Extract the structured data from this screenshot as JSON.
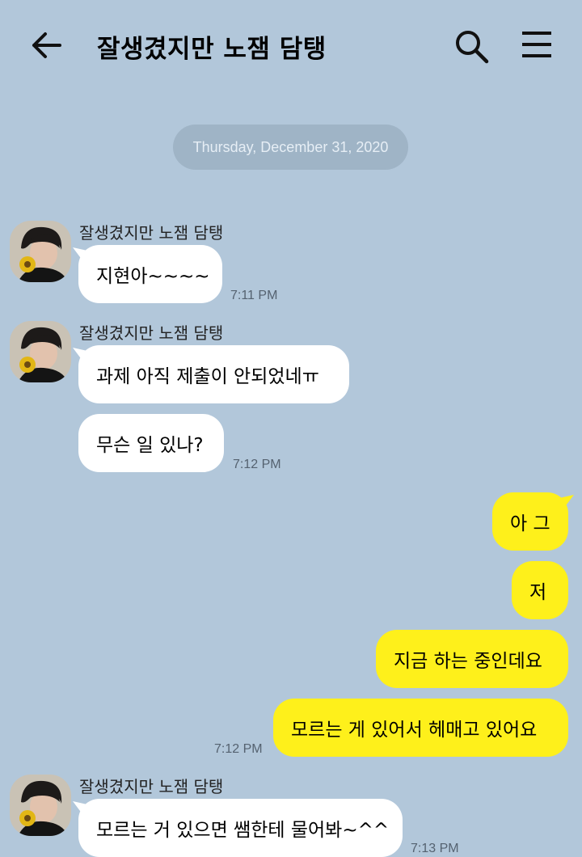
{
  "header": {
    "title": "잘생겼지만 노잼 담탱",
    "back_icon": "arrow-left-icon",
    "search_icon": "search-icon",
    "menu_icon": "hamburger-menu-icon"
  },
  "date_divider": "Thursday, December 31, 2020",
  "sender_name": "잘생겼지만 노잼 담탱",
  "messages": [
    {
      "text": "지현아~~~~",
      "time": "7:11 PM"
    },
    {
      "text": "과제 아직 제출이 안되었네ㅠ"
    },
    {
      "text": "무슨 일 있나?",
      "time": "7:12 PM"
    },
    {
      "text": "아 그"
    },
    {
      "text": "저"
    },
    {
      "text": "지금 하는 중인데요"
    },
    {
      "text": "모르는 게 있어서 헤매고 있어요",
      "time": "7:12 PM"
    },
    {
      "text": "모르는 거 있으면 쌤한테 물어봐~^^",
      "time": "7:13 PM"
    }
  ],
  "colors": {
    "background": "#b2c7da",
    "incoming_bubble": "#ffffff",
    "outgoing_bubble": "#fef01b",
    "date_pill": "#9fb4c6"
  }
}
